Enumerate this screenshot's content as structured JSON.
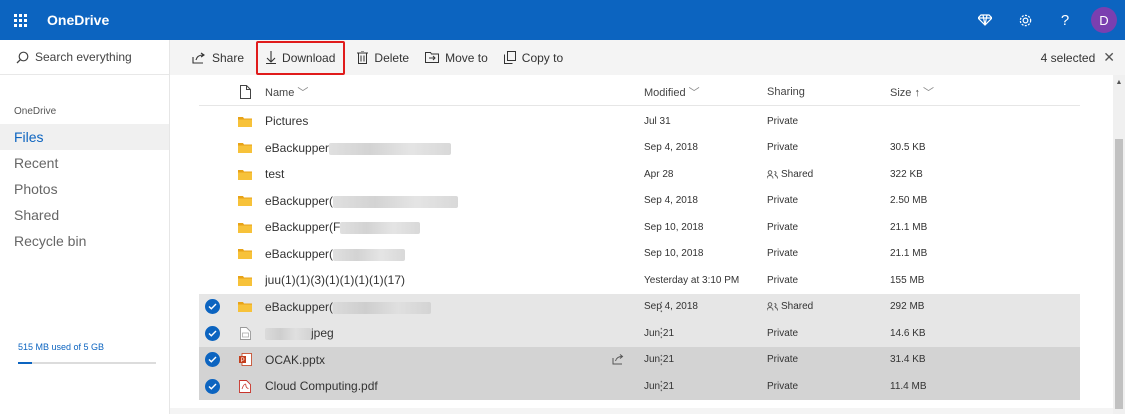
{
  "app": {
    "title": "OneDrive",
    "avatar_initial": "D",
    "brand_color": "#0c64c0",
    "top_icons": [
      "diamond-icon",
      "gear-icon",
      "help-icon"
    ]
  },
  "search": {
    "label": "Search everything"
  },
  "sidebar": {
    "section_label": "OneDrive",
    "items": [
      {
        "label": "Files",
        "active": true
      },
      {
        "label": "Recent"
      },
      {
        "label": "Photos"
      },
      {
        "label": "Shared"
      },
      {
        "label": "Recycle bin"
      }
    ],
    "storage_text": "515 MB used of 5 GB",
    "storage_fraction": 0.1
  },
  "toolbar": {
    "share": "Share",
    "download": "Download",
    "delete": "Delete",
    "move_to": "Move to",
    "copy_to": "Copy to",
    "selected_text": "4 selected"
  },
  "columns": {
    "name": "Name",
    "modified": "Modified",
    "sharing": "Sharing",
    "size": "Size"
  },
  "files": [
    {
      "name": "Pictures",
      "modified": "Jul 31",
      "sharing": "Private",
      "size": "",
      "type": "folder",
      "selected": false
    },
    {
      "name": "eBackupper",
      "modified": "Sep 4, 2018",
      "sharing": "Private",
      "size": "30.5 KB",
      "type": "folder",
      "selected": false,
      "blurred": true
    },
    {
      "name": "test",
      "modified": "Apr 28",
      "sharing": "Shared",
      "size": "322 KB",
      "type": "folder",
      "selected": false
    },
    {
      "name": "eBackupper(",
      "modified": "Sep 4, 2018",
      "sharing": "Private",
      "size": "2.50 MB",
      "type": "folder",
      "selected": false,
      "blurred": true
    },
    {
      "name": "eBackupper(F",
      "modified": "Sep 10, 2018",
      "sharing": "Private",
      "size": "21.1 MB",
      "type": "folder",
      "selected": false,
      "blurred": true
    },
    {
      "name": "eBackupper(",
      "modified": "Sep 10, 2018",
      "sharing": "Private",
      "size": "21.1 MB",
      "type": "folder",
      "selected": false,
      "blurred": true
    },
    {
      "name": "juu(1)(1)(3)(1)(1)(1)(1)(17)",
      "modified": "Yesterday at 3:10 PM",
      "sharing": "Private",
      "size": "155 MB",
      "type": "folder",
      "selected": false
    },
    {
      "name": "eBackupper(",
      "modified": "Sep 4, 2018",
      "sharing": "Shared",
      "size": "292 MB",
      "type": "folder",
      "selected": true,
      "blurred": true
    },
    {
      "name": "jpeg",
      "modified": "Jun 21",
      "sharing": "Private",
      "size": "14.6 KB",
      "type": "image",
      "selected": true,
      "blurred_prefix": true
    },
    {
      "name": "OCAK.pptx",
      "modified": "Jun 21",
      "sharing": "Private",
      "size": "31.4 KB",
      "type": "pptx",
      "selected": true,
      "dark": true
    },
    {
      "name": "Cloud Computing.pdf",
      "modified": "Jun 21",
      "sharing": "Private",
      "size": "11.4 MB",
      "type": "pdf",
      "selected": true,
      "dark": true
    }
  ]
}
